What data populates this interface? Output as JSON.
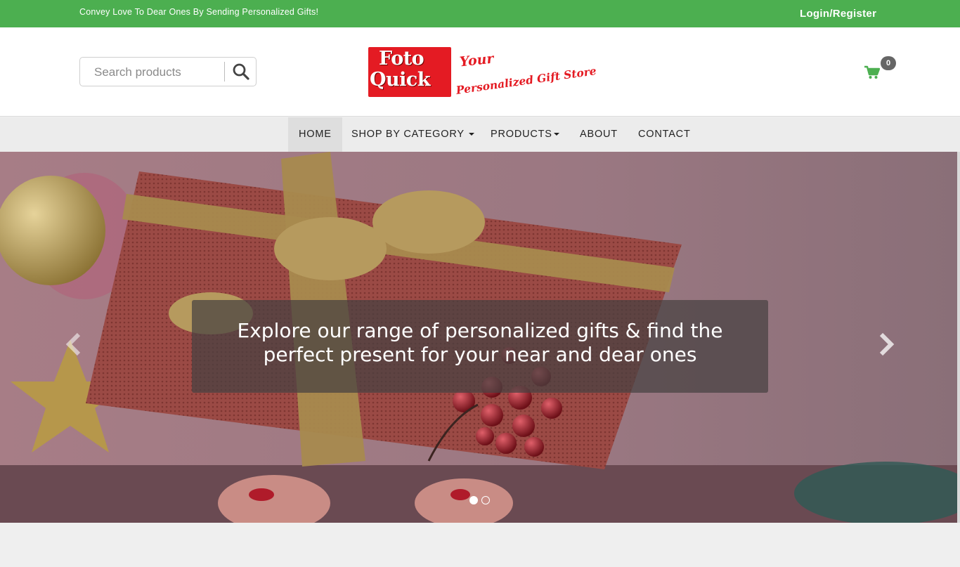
{
  "topbar": {
    "tagline": "Convey Love To Dear Ones By Sending Personalized Gifts!",
    "login_label": "Login/Register"
  },
  "header": {
    "search_placeholder": "Search products",
    "search_icon": "search-icon",
    "logo": {
      "line1": "Foto",
      "line2": "Quick",
      "tagline1": "Your",
      "tagline2": "Personalized Gift Store"
    },
    "cart_icon": "shopping-cart-icon",
    "cart_count": "0"
  },
  "nav": {
    "items": [
      {
        "label": "HOME",
        "active": true,
        "dropdown": false
      },
      {
        "label": "SHOP BY CATEGORY",
        "active": false,
        "dropdown": true
      },
      {
        "label": "PRODUCTS",
        "active": false,
        "dropdown": true
      },
      {
        "label": "ABOUT",
        "active": false,
        "dropdown": false
      },
      {
        "label": "CONTACT",
        "active": false,
        "dropdown": false
      }
    ]
  },
  "hero": {
    "caption_line1": "Explore our range of personalized gifts & find the",
    "caption_line2": "perfect present for your near and dear ones",
    "prev_icon": "chevron-left-icon",
    "next_icon": "chevron-right-icon",
    "slide_count": 2,
    "active_slide": 1
  },
  "colors": {
    "topbar": "#4caf50",
    "logo_red": "#e41b23",
    "cart_green": "#4caf50"
  }
}
